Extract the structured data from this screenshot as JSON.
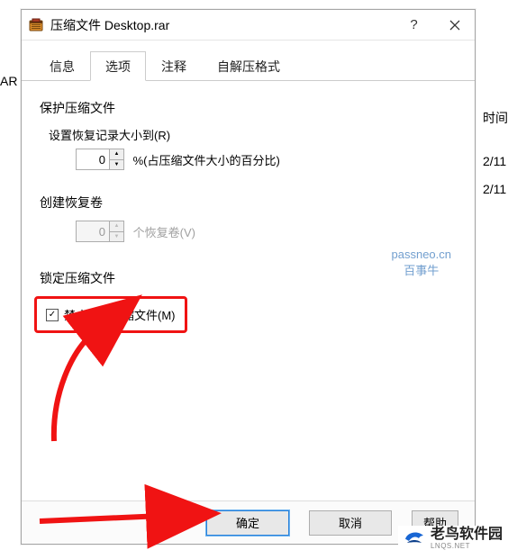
{
  "window": {
    "title": "压缩文件 Desktop.rar"
  },
  "tabs": {
    "info": "信息",
    "options": "选项",
    "comment": "注释",
    "sfx": "自解压格式"
  },
  "sections": {
    "protect": {
      "title": "保护压缩文件",
      "recovery_label_full": "设置恢复记录大小到(R)",
      "recovery_value": "0",
      "recovery_suffix": "%(占压缩文件大小的百分比)"
    },
    "volumes": {
      "title": "创建恢复卷",
      "volumes_value": "0",
      "volumes_suffix_full": "个恢复卷(V)"
    },
    "lock": {
      "title": "锁定压缩文件",
      "checkbox_label_full": "禁止修改压缩文件(M)",
      "checked": true
    }
  },
  "watermark": {
    "line1": "passneo.cn",
    "line2": "百事牛"
  },
  "buttons": {
    "ok": "确定",
    "cancel": "取消",
    "help": "帮助"
  },
  "background": {
    "left_label": "AR 压",
    "right_header": "时间",
    "right_row1": "2/11",
    "right_row2": "2/11"
  },
  "corner_logo": {
    "text": "老鸟软件园",
    "sub": "LNQS.NET"
  }
}
